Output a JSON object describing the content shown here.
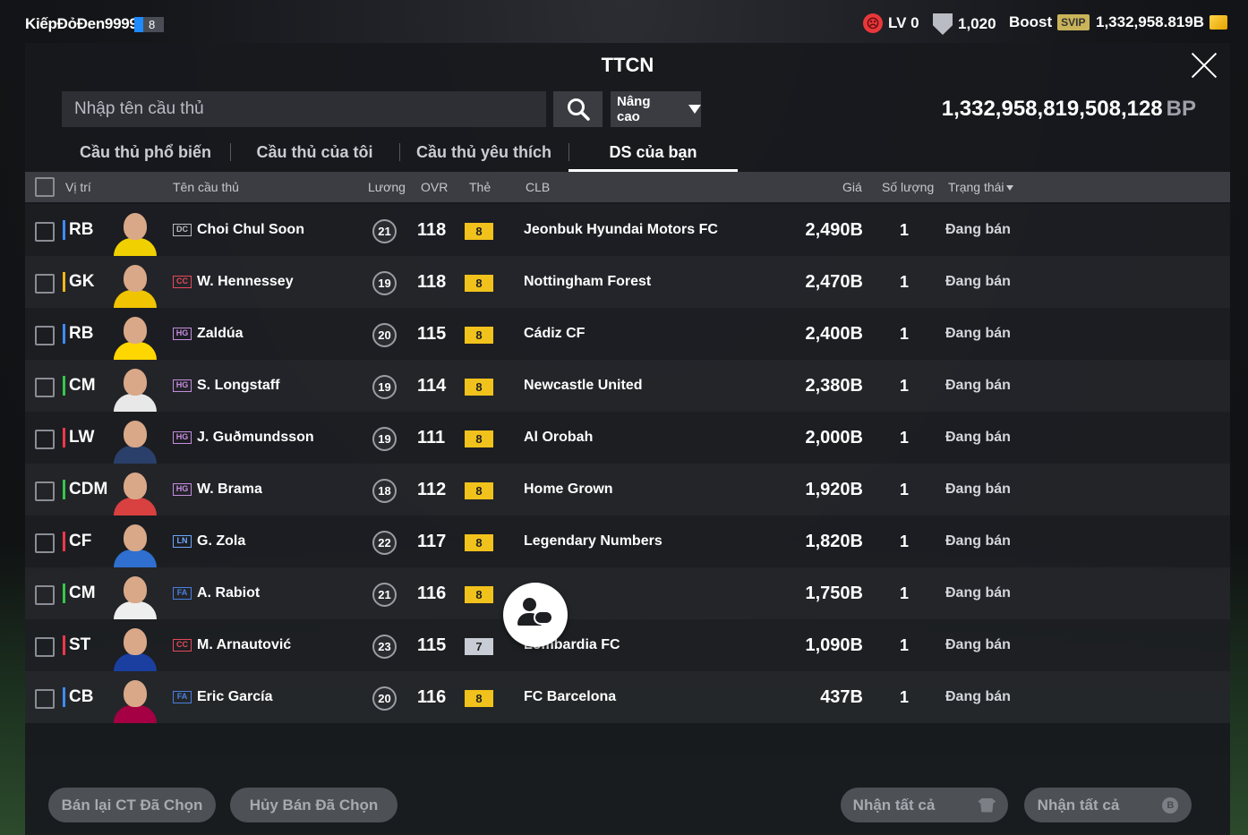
{
  "user": {
    "name": "KiếpĐỏĐen9999",
    "level": "8"
  },
  "stats": {
    "lv": "LV 0",
    "shield_value": "1,020",
    "boost": "Boost",
    "svip": "SVIP",
    "currency": "1,332,958.819B"
  },
  "title": "TTCN",
  "search": {
    "placeholder": "Nhập tên cầu thủ",
    "advanced": "Nâng cao"
  },
  "bp": {
    "value": "1,332,958,819,508,128",
    "unit": "BP"
  },
  "tabs": [
    "Cầu thủ phổ biến",
    "Cầu thủ của tôi",
    "Cầu thủ yêu thích",
    "DS của bạn"
  ],
  "active_tab": 3,
  "headers": {
    "position": "Vị trí",
    "name": "Tên cầu thủ",
    "salary": "Lương",
    "ovr": "OVR",
    "card": "Thẻ",
    "club": "CLB",
    "price": "Giá",
    "qty": "Số lượng",
    "status": "Trạng thái"
  },
  "rows": [
    {
      "pos": "RB",
      "pos_color": "#3e8bff",
      "season": "DC",
      "season_color": "#b9bcc3",
      "name": "Choi Chul Soon",
      "salary": "21",
      "ovr": "118",
      "card": "8",
      "card_color": "#f1c21b",
      "club": "Jeonbuk Hyundai Motors FC",
      "price": "2,490B",
      "qty": "1",
      "status": "Đang bán",
      "shirt": "#f0d000"
    },
    {
      "pos": "GK",
      "pos_color": "#f3b61f",
      "season": "CC",
      "season_color": "#e5495a",
      "name": "W. Hennessey",
      "salary": "19",
      "ovr": "118",
      "card": "8",
      "card_color": "#f1c21b",
      "club": "Nottingham Forest",
      "price": "2,470B",
      "qty": "1",
      "status": "Đang bán",
      "shirt": "#f0c400"
    },
    {
      "pos": "RB",
      "pos_color": "#3e8bff",
      "season": "HG",
      "season_color": "#c58de0",
      "name": "Zaldúa",
      "salary": "20",
      "ovr": "115",
      "card": "8",
      "card_color": "#f1c21b",
      "club": "Cádiz CF",
      "price": "2,400B",
      "qty": "1",
      "status": "Đang bán",
      "shirt": "#ffd700"
    },
    {
      "pos": "CM",
      "pos_color": "#35c84a",
      "season": "HG",
      "season_color": "#c58de0",
      "name": "S. Longstaff",
      "salary": "19",
      "ovr": "114",
      "card": "8",
      "card_color": "#f1c21b",
      "club": "Newcastle United",
      "price": "2,380B",
      "qty": "1",
      "status": "Đang bán",
      "shirt": "#e8e8e8"
    },
    {
      "pos": "LW",
      "pos_color": "#f0364a",
      "season": "HG",
      "season_color": "#c58de0",
      "name": "J. Guðmundsson",
      "salary": "19",
      "ovr": "111",
      "card": "8",
      "card_color": "#f1c21b",
      "club": "Al Orobah",
      "price": "2,000B",
      "qty": "1",
      "status": "Đang bán",
      "shirt": "#2a3f6a"
    },
    {
      "pos": "CDM",
      "pos_color": "#35c84a",
      "season": "HG",
      "season_color": "#c58de0",
      "name": "W. Brama",
      "salary": "18",
      "ovr": "112",
      "card": "8",
      "card_color": "#f1c21b",
      "club": "Home Grown",
      "price": "1,920B",
      "qty": "1",
      "status": "Đang bán",
      "shirt": "#d94040"
    },
    {
      "pos": "CF",
      "pos_color": "#f0364a",
      "season": "LN",
      "season_color": "#6aa8ff",
      "name": "G. Zola",
      "salary": "22",
      "ovr": "117",
      "card": "8",
      "card_color": "#f1c21b",
      "club": "Legendary Numbers",
      "price": "1,820B",
      "qty": "1",
      "status": "Đang bán",
      "shirt": "#2f6fcf"
    },
    {
      "pos": "CM",
      "pos_color": "#35c84a",
      "season": "FA",
      "season_color": "#4a7fe0",
      "name": "A. Rabiot",
      "salary": "21",
      "ovr": "116",
      "card": "8",
      "card_color": "#f1c21b",
      "club": "",
      "price": "1,750B",
      "qty": "1",
      "status": "Đang bán",
      "shirt": "#eeeeee"
    },
    {
      "pos": "ST",
      "pos_color": "#f0364a",
      "season": "CC",
      "season_color": "#e5495a",
      "name": "M. Arnautović",
      "salary": "23",
      "ovr": "115",
      "card": "7",
      "card_color": "#c8ccd4",
      "club": "Lombardia FC",
      "price": "1,090B",
      "qty": "1",
      "status": "Đang bán",
      "shirt": "#1a3fa0"
    },
    {
      "pos": "CB",
      "pos_color": "#3e8bff",
      "season": "FA",
      "season_color": "#4a7fe0",
      "name": "Eric García",
      "salary": "20",
      "ovr": "116",
      "card": "8",
      "card_color": "#f1c21b",
      "club": "FC Barcelona",
      "price": "437B",
      "qty": "1",
      "status": "Đang bán",
      "shirt": "#a50044"
    }
  ],
  "buttons": {
    "resell": "Bán lại CT Đã Chọn",
    "cancel": "Hủy Bán Đã Chọn",
    "receive_all_1": "Nhận tất cả",
    "receive_all_2": "Nhận tất cả"
  }
}
